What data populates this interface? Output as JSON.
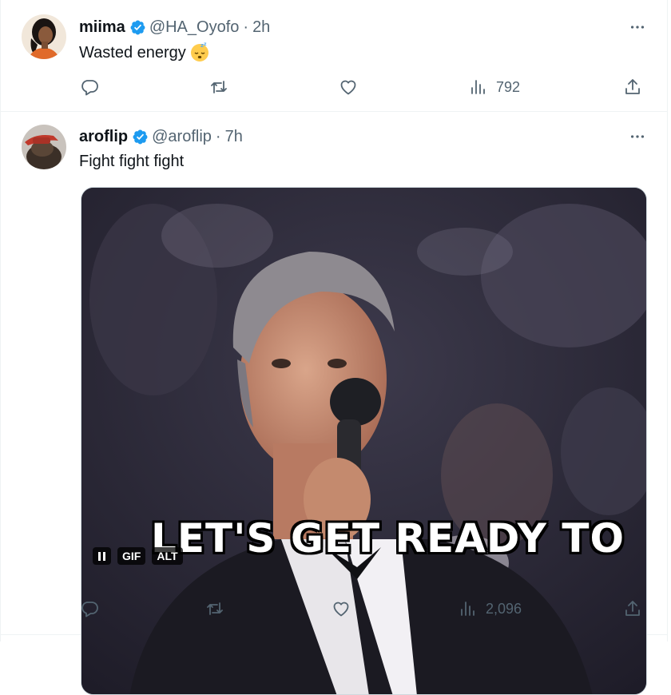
{
  "tweets": [
    {
      "name": "miima",
      "handle": "@HA_Oyofo",
      "separator": "·",
      "time": "2h",
      "text": "Wasted  energy",
      "emoji": "sleeping-face",
      "stats": {
        "views": "792"
      }
    },
    {
      "name": "aroflip",
      "handle": "@aroflip",
      "separator": "·",
      "time": "7h",
      "text": "Fight fight fight",
      "media": {
        "caption": "LET'S GET READY TO",
        "gif_label": "GIF",
        "alt_label": "ALT"
      },
      "stats": {
        "views": "2,096"
      }
    }
  ],
  "colors": {
    "text": "#0f1419",
    "secondary": "#536471",
    "verified": "#1d9bf0",
    "divider": "#eff3f4"
  },
  "icons": [
    "verified-badge-icon",
    "more-icon",
    "reply-icon",
    "retweet-icon",
    "like-icon",
    "views-icon",
    "share-icon",
    "pause-icon"
  ]
}
